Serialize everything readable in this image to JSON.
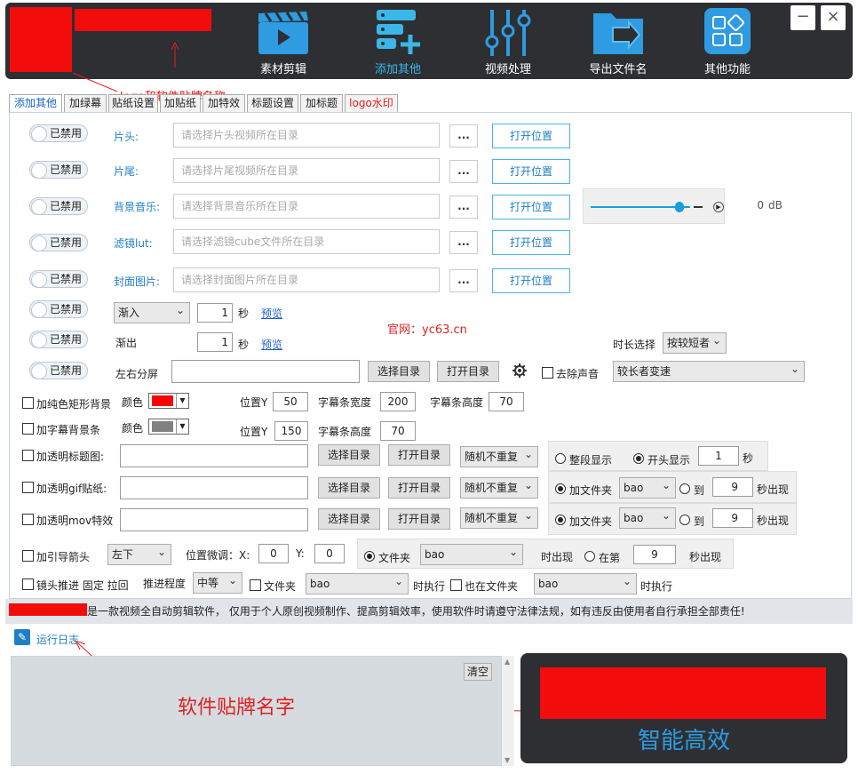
{
  "colors": {
    "accent": "#3ab7e8",
    "header_bg": "#2d2f33",
    "red_mask": "#f20c0c"
  },
  "header": {
    "nav": [
      {
        "label": "素材剪辑",
        "icon": "clapper-icon"
      },
      {
        "label": "添加其他",
        "icon": "add-list-icon"
      },
      {
        "label": "视频处理",
        "icon": "sliders-icon"
      },
      {
        "label": "导出文件名",
        "icon": "export-folder-icon"
      },
      {
        "label": "其他功能",
        "icon": "grid-apps-icon"
      }
    ],
    "minimize": "−",
    "close": "×"
  },
  "annotations": {
    "logo_note": "logo和软件贴牌名称",
    "site": "官网：yc63.cn",
    "brand_note": "软件贴牌名字",
    "slogan": "智能高效"
  },
  "tabs": [
    "添加其他",
    "加绿幕",
    "贴纸设置",
    "加贴纸",
    "加特效",
    "标题设置",
    "加标题",
    "logo水印"
  ],
  "disabled_label": "已禁用",
  "dots": "...",
  "open_label": "打开位置",
  "file_rows": [
    {
      "label": "片头:",
      "placeholder": "请选择片头视频所在目录"
    },
    {
      "label": "片尾:",
      "placeholder": "请选择片尾视频所在目录"
    },
    {
      "label": "背景音乐:",
      "placeholder": "请选择背景音乐所在目录"
    },
    {
      "label": "滤镜lut:",
      "placeholder": "请选择滤镜cube文件所在目录"
    },
    {
      "label": "封面图片:",
      "placeholder": "请选择封面图片所在目录"
    }
  ],
  "volume": {
    "value": "0",
    "unit": "dB",
    "level": 0.85
  },
  "fade_in": {
    "select": "渐入",
    "value": "1",
    "unit": "秒",
    "preview": "预览"
  },
  "fade_out": {
    "label": "渐出",
    "value": "1",
    "unit": "秒",
    "preview": "预览"
  },
  "duration": {
    "label": "时长选择",
    "select": "按较短者"
  },
  "split": {
    "label": "左右分屏",
    "choose": "选择目录",
    "open": "打开目录",
    "mute": "去除声音",
    "speed": "较长者变速"
  },
  "solid_bg": {
    "label": "加纯色矩形背景",
    "color_label": "颜色",
    "pos_label": "位置Y",
    "pos": "50",
    "w_label": "字幕条宽度",
    "w": "200",
    "h_label": "字幕条高度",
    "h": "70",
    "swatch": "#ff0000"
  },
  "sub_bg": {
    "label": "加字幕背景条",
    "color_label": "颜色",
    "pos_label": "位置Y",
    "pos": "150",
    "h_label": "字幕条高度",
    "h": "70",
    "swatch": "#808080"
  },
  "trans_rows": [
    {
      "label": "加透明标题图:",
      "choose": "选择目录",
      "open": "打开目录",
      "mode": "随机不重复"
    },
    {
      "label": "加透明gif贴纸:",
      "choose": "选择目录",
      "open": "打开目录",
      "mode": "随机不重复"
    },
    {
      "label": "加透明mov特效",
      "choose": "选择目录",
      "open": "打开目录",
      "mode": "随机不重复"
    }
  ],
  "title_opts": {
    "whole": "整段显示",
    "start": "开头显示",
    "value": "1",
    "unit": "秒"
  },
  "gif_opts": {
    "folder": "加文件夹",
    "select": "bao",
    "to": "到",
    "value": "9",
    "suffix": "秒出现"
  },
  "mov_opts": {
    "folder": "加文件夹",
    "select": "bao",
    "to": "到",
    "value": "9",
    "suffix": "秒出现"
  },
  "arrow": {
    "label": "加引导箭头",
    "pos": "左下",
    "adj": "位置微调：X:",
    "x": "0",
    "y_label": "Y:",
    "y": "0",
    "folder": "文件夹",
    "select": "bao",
    "appear": "时出现",
    "at": "在第",
    "value": "9",
    "suffix": "秒出现"
  },
  "lens": {
    "label": "镜头推进 固定 拉回",
    "degree_label": "推进程度",
    "degree": "中等",
    "folder": "文件夹",
    "select": "bao",
    "exec": "时执行",
    "also": "也在文件夹",
    "select2": "bao",
    "exec2": "时执行"
  },
  "notice": "是一款视频全自动剪辑软件， 仅用于个人原创视频制作、提高剪辑效率，使用软件时请遵守法律法规，如有违反由使用者自行承担全部责任!",
  "log": {
    "title": "运行日志",
    "clear": "清空"
  }
}
